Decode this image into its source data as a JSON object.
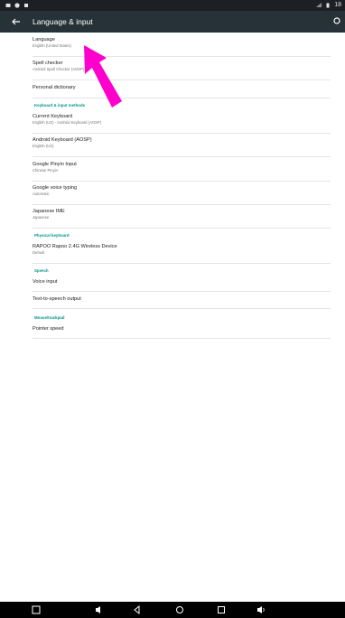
{
  "status_bar": {
    "time": "18",
    "left_icons": [
      "notification-icon",
      "info-icon",
      "usb-icon"
    ],
    "right_icons": [
      "wifi-icon",
      "battery-icon"
    ]
  },
  "app_bar": {
    "title": "Language & input",
    "back_icon": "arrow-back-icon",
    "search_icon": "search-icon",
    "background": "#263238"
  },
  "accent_color": "#009688",
  "items": {
    "language": {
      "title": "Language",
      "summary": "English (United States)"
    },
    "spell_checker": {
      "title": "Spell checker",
      "summary": "Android Spell Checker (AOSP)"
    },
    "personal_dictionary": {
      "title": "Personal dictionary"
    }
  },
  "sections": {
    "keyboard_input": {
      "header": "Keyboard & input methods",
      "items": [
        {
          "title": "Current Keyboard",
          "summary": "English (US) - Android Keyboard (AOSP)"
        },
        {
          "title": "Android Keyboard (AOSP)",
          "summary": "English (US)"
        },
        {
          "title": "Google Pinyin Input",
          "summary": "Chinese Pinyin"
        },
        {
          "title": "Google voice typing",
          "summary": "Automatic"
        },
        {
          "title": "Japanese IME",
          "summary": "Japanese"
        }
      ]
    },
    "physical_keyboard": {
      "header": "Physical keyboard",
      "items": [
        {
          "title": "RAPOO Rapoo 2.4G Wireless Device",
          "summary": "Default"
        }
      ]
    },
    "speech": {
      "header": "Speech",
      "items": [
        {
          "title": "Voice input"
        },
        {
          "title": "Text-to-speech output"
        }
      ]
    },
    "mouse": {
      "header": "Mouse/trackpad",
      "items": [
        {
          "title": "Pointer speed"
        }
      ]
    }
  },
  "nav_bar": {
    "buttons": [
      "screenshot-icon",
      "volume-down-icon",
      "back-icon",
      "home-icon",
      "recents-icon",
      "volume-up-icon"
    ]
  },
  "annotation": {
    "arrow_color": "#ff00cc"
  }
}
